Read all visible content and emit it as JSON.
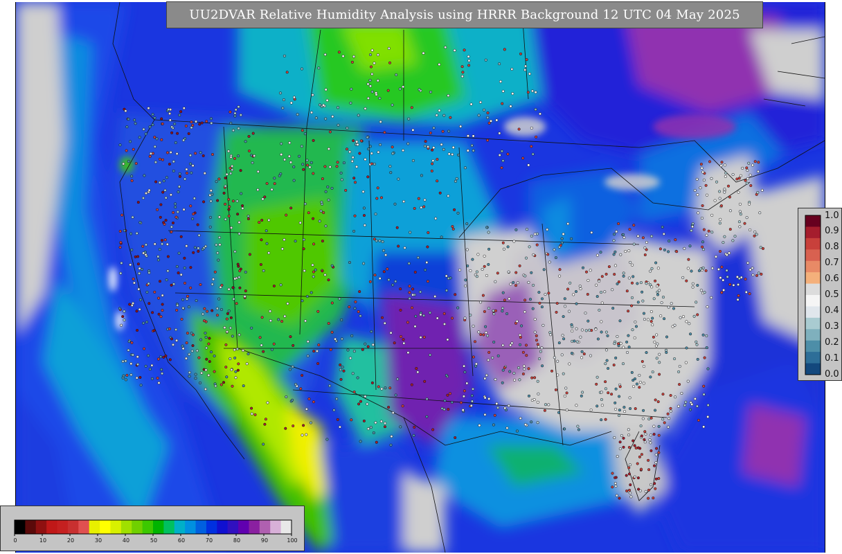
{
  "title": "UU2DVAR Relative Humidity Analysis using HRRR Background 12 UTC 04 May 2025",
  "observation_colorbar": {
    "labels": [
      "1.0",
      "0.9",
      "0.8",
      "0.7",
      "0.6",
      "0.5",
      "0.4",
      "0.3",
      "0.2",
      "0.1",
      "0.0"
    ],
    "colors": [
      "#67001f",
      "#a51d2d",
      "#c8403b",
      "#d86150",
      "#e88a66",
      "#f4b07b",
      "#dcdcdc",
      "#f5f5f5",
      "#e0e6ec",
      "#a9cbd1",
      "#7fb0bd",
      "#4d8ea8",
      "#2d6e98",
      "#13487d"
    ]
  },
  "rh_colorbar": {
    "labels": [
      "0",
      "10",
      "20",
      "30",
      "40",
      "50",
      "60",
      "70",
      "80",
      "90",
      "100"
    ],
    "colors": [
      "#000000",
      "#5a0a0a",
      "#8f1010",
      "#c01818",
      "#c52020",
      "#c83030",
      "#e05050",
      "#e8f000",
      "#ffff00",
      "#d8f000",
      "#a0e000",
      "#70d000",
      "#3cc800",
      "#00b400",
      "#00c060",
      "#00b0c8",
      "#0090e0",
      "#0060e0",
      "#0030e0",
      "#1010d0",
      "#3010c0",
      "#6000b0",
      "#8a20a0",
      "#b060b0",
      "#d8b0d8",
      "#e8e8e8"
    ]
  }
}
